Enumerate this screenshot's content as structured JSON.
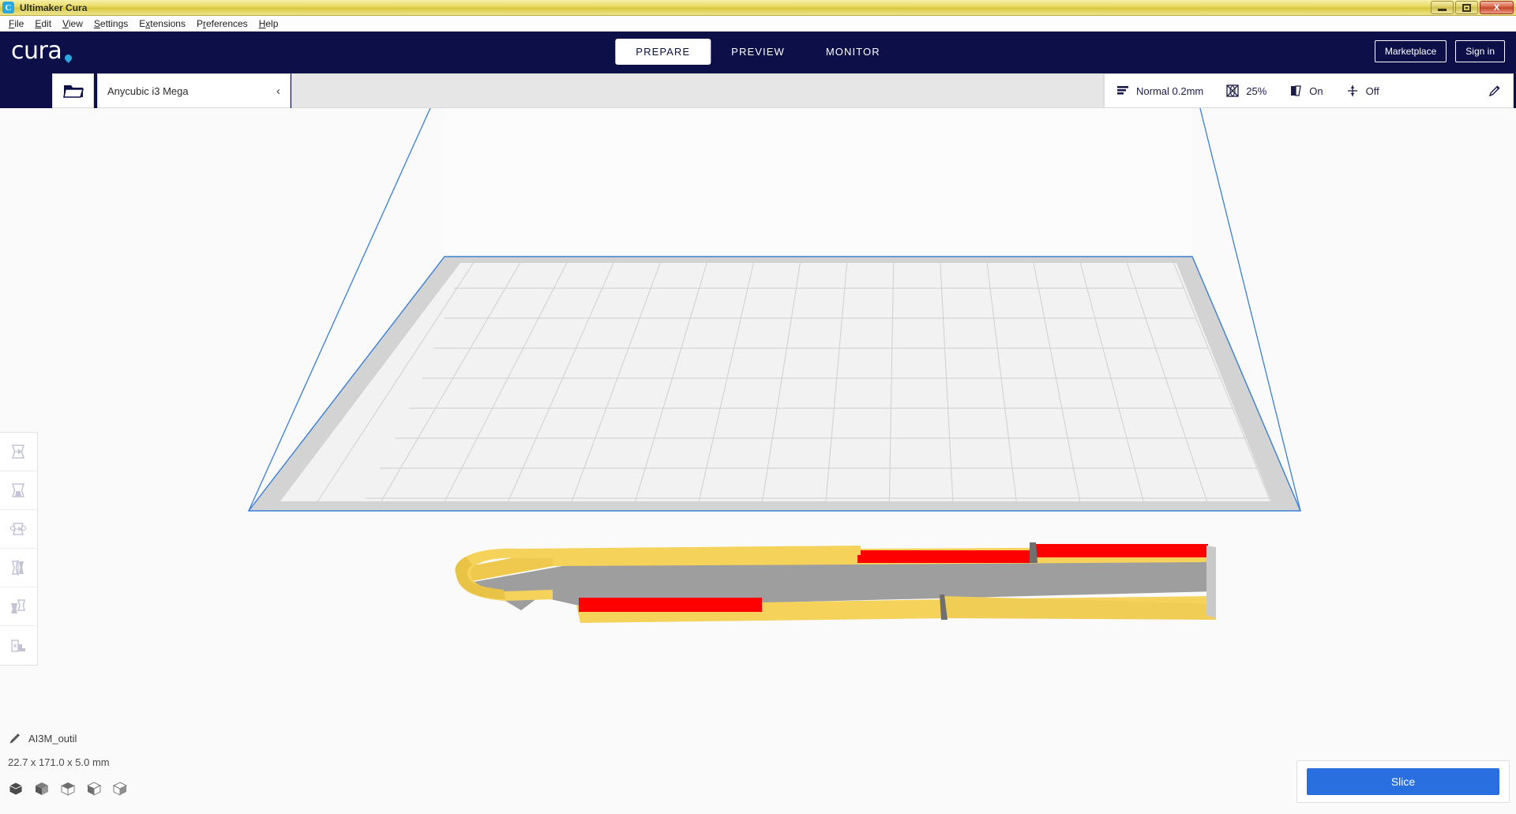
{
  "window": {
    "title": "Ultimaker Cura",
    "app_icon": "cura-logo-icon",
    "minimize_label": "Minimize",
    "restore_label": "Restore",
    "close_label": "X"
  },
  "menubar": {
    "items": [
      {
        "acc": "F",
        "rest": "ile"
      },
      {
        "acc": "E",
        "rest": "dit"
      },
      {
        "acc": "V",
        "rest": "iew"
      },
      {
        "acc": "S",
        "rest": "ettings"
      },
      {
        "pre": "E",
        "acc": "x",
        "rest": "tensions"
      },
      {
        "pre": "P",
        "acc": "r",
        "rest": "eferences"
      },
      {
        "acc": "H",
        "rest": "elp"
      }
    ]
  },
  "header": {
    "logo_text": "cura",
    "tabs": [
      {
        "label": "PREPARE",
        "active": true
      },
      {
        "label": "PREVIEW",
        "active": false
      },
      {
        "label": "MONITOR",
        "active": false
      }
    ],
    "marketplace_label": "Marketplace",
    "signin_label": "Sign in",
    "background_color": "#0d1048"
  },
  "subbar": {
    "open_file_icon": "open-folder-icon",
    "printer_name": "Anycubic i3 Mega",
    "printer_chevron": "‹",
    "settings": [
      {
        "icon": "layer-height-icon",
        "label": "Normal 0.2mm"
      },
      {
        "icon": "infill-icon",
        "label": "25%"
      },
      {
        "icon": "support-icon",
        "label": "On"
      },
      {
        "icon": "adhesion-icon",
        "label": "Off"
      }
    ],
    "edit_icon": "pencil-icon"
  },
  "toolbar": {
    "tools": [
      {
        "name": "move-tool",
        "label": "Move"
      },
      {
        "name": "scale-tool",
        "label": "Scale"
      },
      {
        "name": "rotate-tool",
        "label": "Rotate"
      },
      {
        "name": "mirror-tool",
        "label": "Mirror"
      },
      {
        "name": "per-model-settings-tool",
        "label": "Per Model Settings"
      },
      {
        "name": "support-blocker-tool",
        "label": "Support Blocker"
      }
    ]
  },
  "object_info": {
    "edit_icon": "pencil-icon",
    "name": "AI3M_outil",
    "dimensions": "22.7 x 171.0 x 5.0 mm",
    "view_modes": [
      {
        "name": "isometric-view-icon",
        "active": true
      },
      {
        "name": "front-view-icon",
        "active": false
      },
      {
        "name": "top-view-icon",
        "active": false
      },
      {
        "name": "left-view-icon",
        "active": false
      },
      {
        "name": "right-view-icon",
        "active": false
      }
    ]
  },
  "slice_panel": {
    "slice_label": "Slice",
    "button_color": "#2a6fe0"
  },
  "viewport": {
    "background_color": "#fafafa",
    "build_volume_outline_color": "#3a7fd5",
    "buildplate_border_color": "#d3d3d3",
    "buildplate_surface_color": "#f2f2f2",
    "grid_line_color": "#cfcfcf",
    "model_color": "#f5d25a",
    "model_shadow_color": "#9e9e9e",
    "overhang_color": "#ff0000"
  }
}
